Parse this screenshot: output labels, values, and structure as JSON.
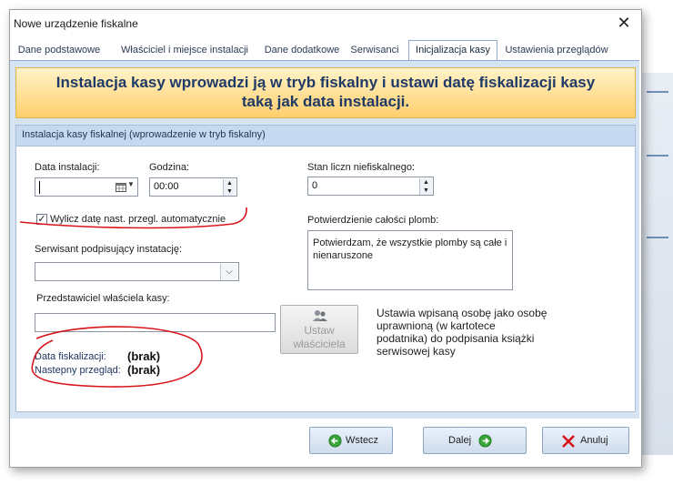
{
  "window": {
    "title": "Nowe urządzenie fiskalne"
  },
  "tabs": [
    {
      "label": "Dane podstawowe"
    },
    {
      "label": "Właściciel i miejsce instalacji"
    },
    {
      "label": "Dane dodatkowe"
    },
    {
      "label": "Serwisanci"
    },
    {
      "label": "Inicjalizacja kasy",
      "active": true
    },
    {
      "label": "Ustawienia przeglądów"
    }
  ],
  "banner": {
    "line1": "Instalacja kasy wprowadzi ją w tryb fiskalny i ustawi datę fiskalizacji kasy",
    "line2": "taką jak data instalacji."
  },
  "group": {
    "title": "Instalacja kasy fiskalnej (wprowadzenie w tryb fiskalny)",
    "install_date_label": "Data instalacji:",
    "install_date_value": "",
    "hour_label": "Godzina:",
    "hour_value": "00:00",
    "counter_label": "Stan liczn niefiskalnego:",
    "counter_value": "0",
    "auto_checkbox_label": "Wylicz datę nast. przegl. automatycznie",
    "auto_checkbox_checked": true,
    "seals_label": "Potwierdzienie całości plomb:",
    "seals_text": "Potwierdzam, że wszystkie plomby są całe i nienaruszone",
    "serviceman_label": "Serwisant podpisujący instatację:",
    "serviceman_value": "",
    "owner_rep_label": "Przedstawiciel właściela kasy:",
    "owner_rep_value": "",
    "set_owner_line1": "Ustaw",
    "set_owner_line2": "właściciela",
    "set_owner_help": "Ustawia wpisaną osobę jako osobę uprawnioną (w kartotece podatnika) do podpisania książki serwisowej kasy",
    "fiscal_date_label": "Data fiskalizacji:",
    "fiscal_date_value": "(brak)",
    "next_review_label": "Nastepny przegląd:",
    "next_review_value": "(brak)"
  },
  "footer": {
    "back_label": "Wstecz",
    "next_label": "Dalej",
    "cancel_label": "Anuluj"
  },
  "colors": {
    "accent": "#1f3a66",
    "annotation_red": "#d8141b",
    "nav_green": "#3aa53a"
  }
}
